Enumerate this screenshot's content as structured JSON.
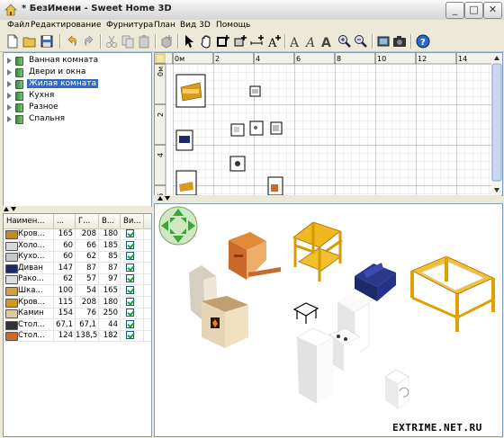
{
  "window": {
    "title": "* БезИмени - Sweet Home 3D"
  },
  "menu": [
    "Файл",
    "Редактирование",
    "Фурнитура",
    "План",
    "Вид 3D",
    "Помощь"
  ],
  "toolbar_icons": [
    "new-file-icon",
    "open-folder-icon",
    "save-icon",
    "undo-icon",
    "redo-icon",
    "cut-icon",
    "copy-icon",
    "paste-icon",
    "add-furniture-icon",
    "select-pointer-icon",
    "pan-hand-icon",
    "create-walls-icon",
    "create-rooms-icon",
    "create-dimensions-icon",
    "add-text-icon",
    "text-style-icon",
    "text-italic-icon",
    "text-bold-icon",
    "zoom-in-icon",
    "zoom-out-icon",
    "create-photo-icon",
    "photo-camera-icon",
    "help-icon"
  ],
  "catalog": {
    "categories": [
      "Ванная комната",
      "Двери и окна",
      "Жилая комната",
      "Кухня",
      "Разное",
      "Спальня"
    ],
    "selected": "Жилая комната"
  },
  "furniture_table": {
    "columns": [
      "Наимен...",
      "...",
      "Г...",
      "В...",
      "Ви..."
    ],
    "rows": [
      {
        "name": "Кров...",
        "w": "165",
        "d": "208",
        "h": "180",
        "visible": true,
        "icon": "bed-icon",
        "color": "#c08a2a"
      },
      {
        "name": "Холо...",
        "w": "60",
        "d": "66",
        "h": "185",
        "visible": true,
        "icon": "fridge-icon",
        "color": "#d8d8d8"
      },
      {
        "name": "Кухо...",
        "w": "60",
        "d": "62",
        "h": "85",
        "visible": true,
        "icon": "kitchen-stove-icon",
        "color": "#c8c8c8"
      },
      {
        "name": "Диван",
        "w": "147",
        "d": "87",
        "h": "87",
        "visible": true,
        "icon": "sofa-icon",
        "color": "#1c2a6a"
      },
      {
        "name": "Рако...",
        "w": "62",
        "d": "57",
        "h": "97",
        "visible": true,
        "icon": "sink-icon",
        "color": "#dcdcdc"
      },
      {
        "name": "Шка...",
        "w": "100",
        "d": "54",
        "h": "165",
        "visible": true,
        "icon": "cabinet-icon",
        "color": "#c9a24a"
      },
      {
        "name": "Кров...",
        "w": "115",
        "d": "208",
        "h": "180",
        "visible": true,
        "icon": "bed-icon",
        "color": "#d39a20"
      },
      {
        "name": "Камин",
        "w": "154",
        "d": "76",
        "h": "250",
        "visible": true,
        "icon": "fireplace-icon",
        "color": "#e0c9a0"
      },
      {
        "name": "Стол...",
        "w": "67,1",
        "d": "67,1",
        "h": "44",
        "visible": true,
        "icon": "table-icon",
        "color": "#333333"
      },
      {
        "name": "Стол...",
        "w": "124",
        "d": "138,5",
        "h": "182",
        "visible": true,
        "icon": "desk-icon",
        "color": "#c96a2a"
      }
    ]
  },
  "plan": {
    "ruler_top": [
      "0м",
      "2",
      "4",
      "6",
      "8",
      "10",
      "12",
      "14"
    ],
    "ruler_left": [
      "0м",
      "2",
      "4",
      "6"
    ]
  },
  "watermark": "EXTRIME.NET.RU"
}
